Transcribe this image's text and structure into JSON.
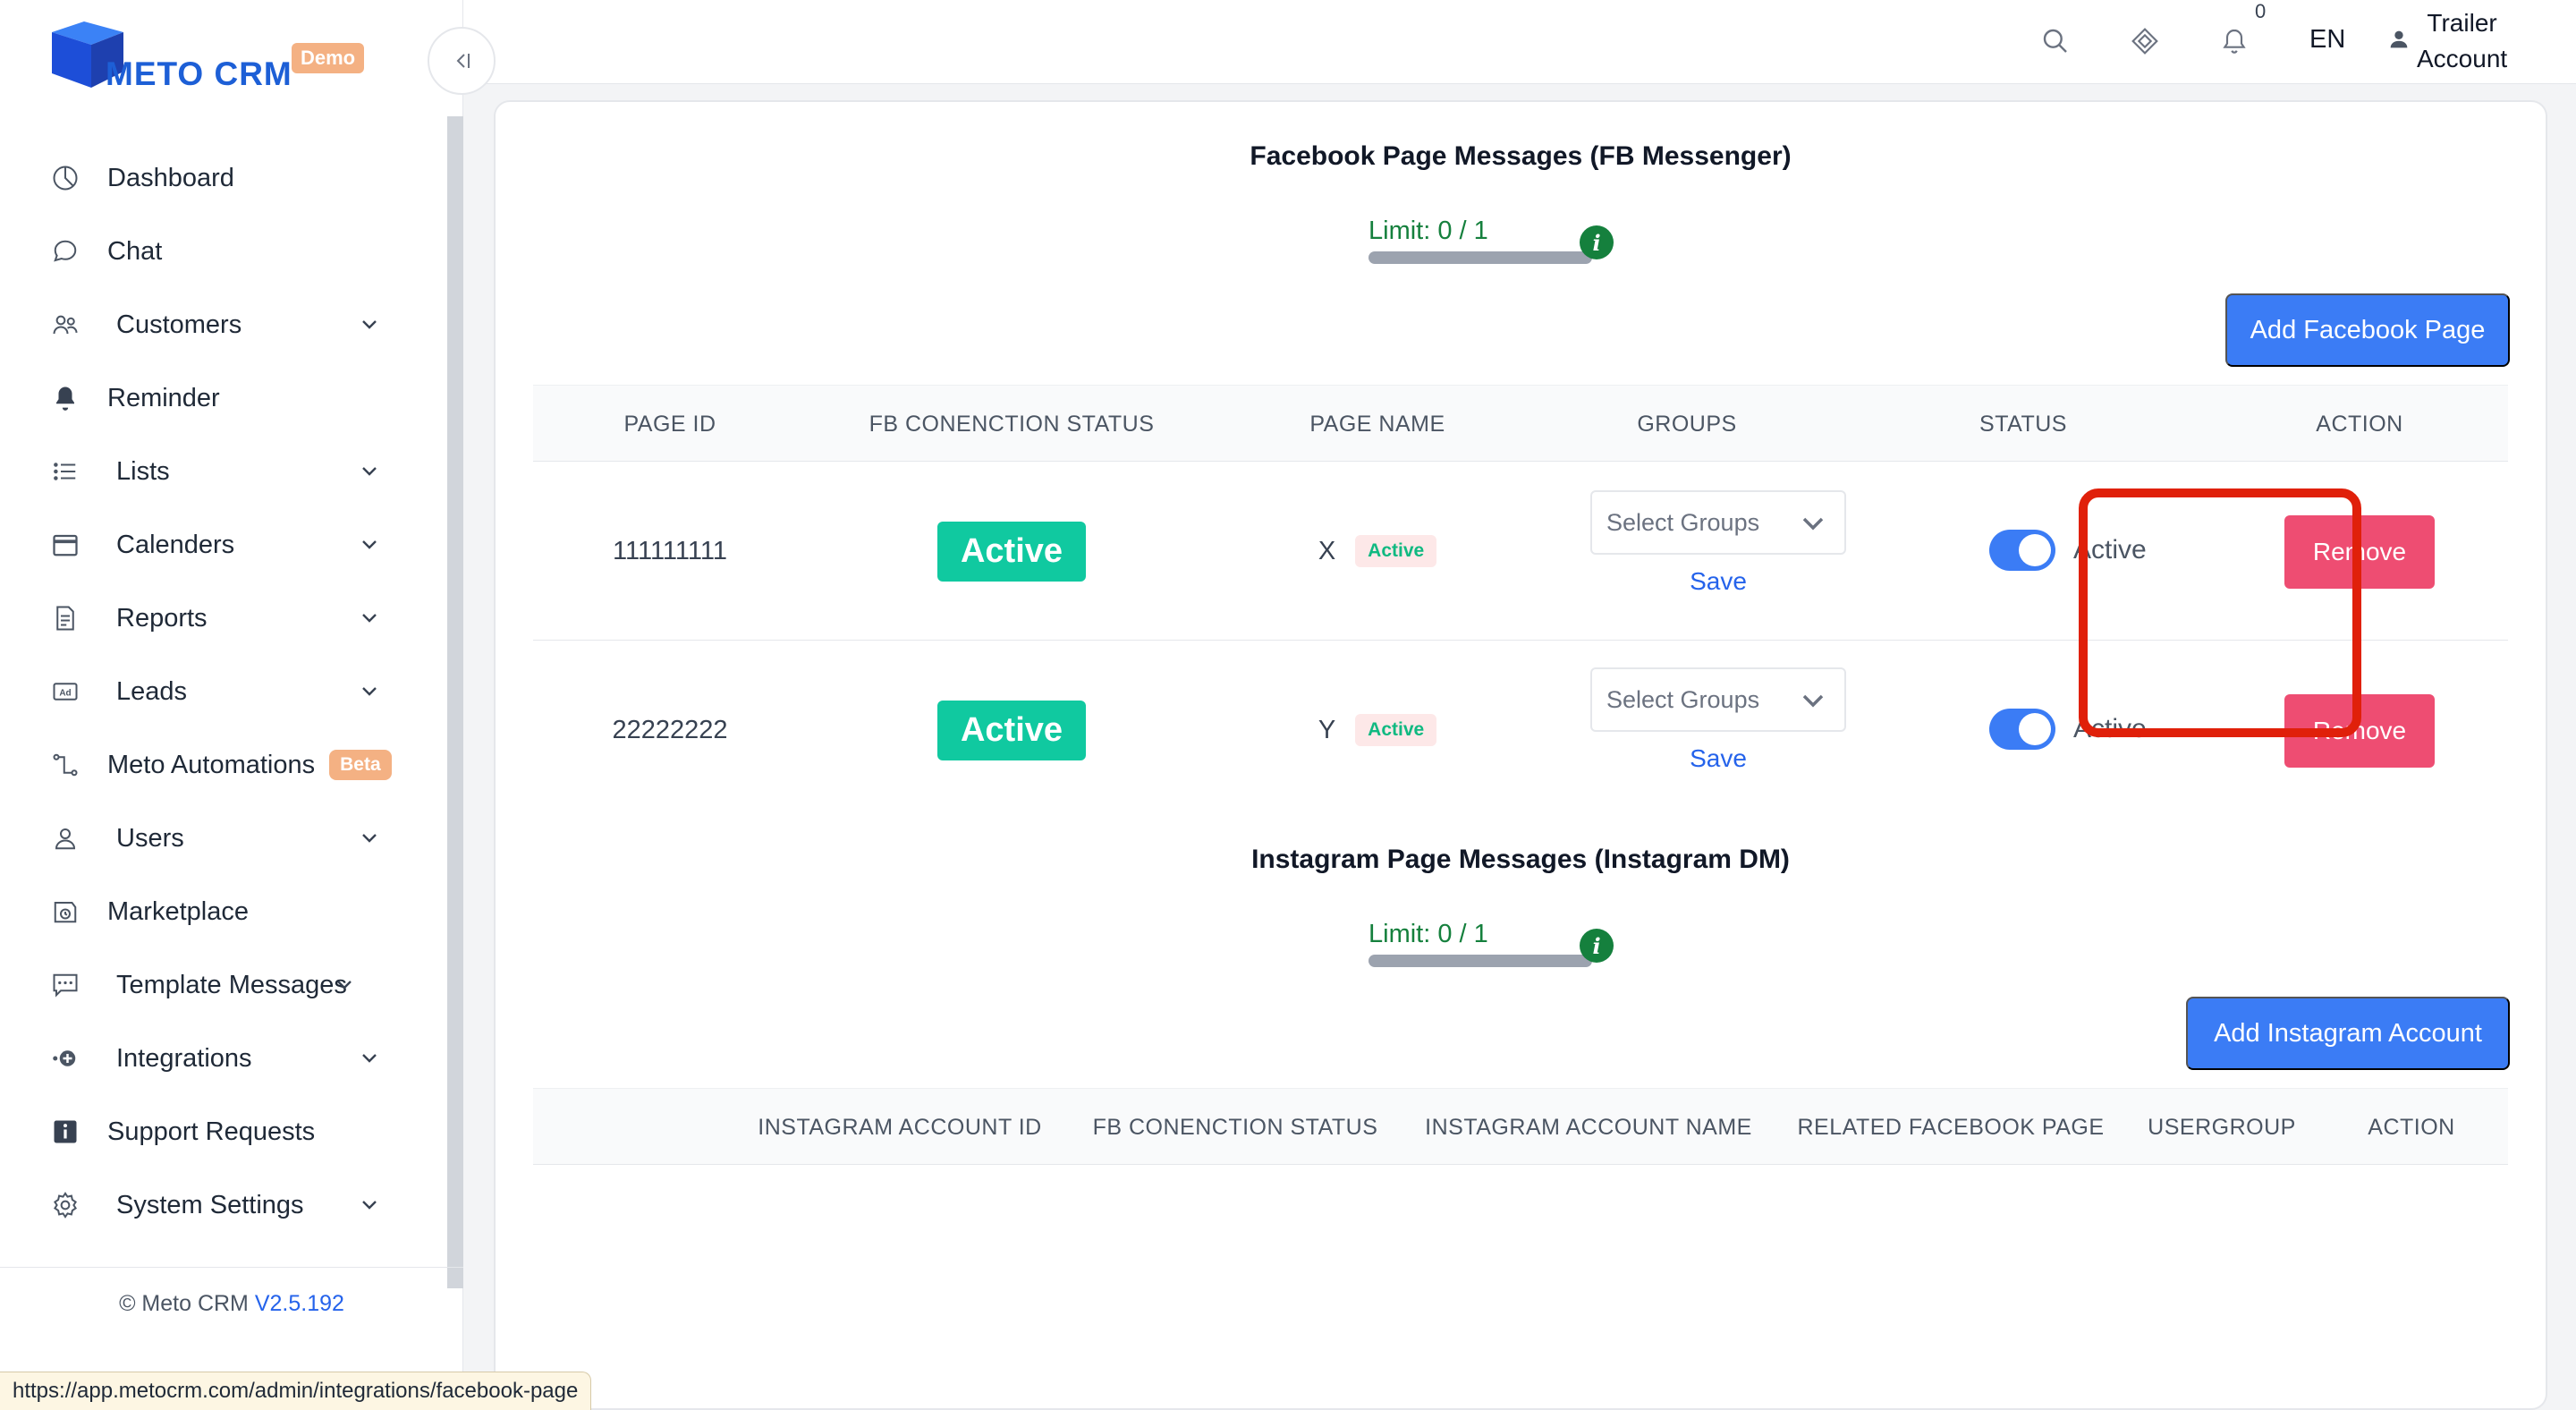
{
  "app": {
    "logo_text": "METO CRM",
    "logo_badge": "Demo",
    "brand_color": "#1d5fd6"
  },
  "sidebar": {
    "items": [
      {
        "label": "Dashboard",
        "icon": "pie-chart-icon",
        "has_submenu": false
      },
      {
        "label": "Chat",
        "icon": "chat-bubble-icon",
        "has_submenu": false
      },
      {
        "label": "Customers",
        "icon": "users-icon",
        "has_submenu": true
      },
      {
        "label": "Reminder",
        "icon": "bell-icon",
        "has_submenu": false
      },
      {
        "label": "Lists",
        "icon": "list-icon",
        "has_submenu": true
      },
      {
        "label": "Calenders",
        "icon": "calendar-icon",
        "has_submenu": true
      },
      {
        "label": "Reports",
        "icon": "document-icon",
        "has_submenu": true
      },
      {
        "label": "Leads",
        "icon": "ad-icon",
        "has_submenu": true
      },
      {
        "label": "Meto Automations",
        "icon": "flow-icon",
        "has_submenu": false,
        "badge": "Beta"
      },
      {
        "label": "Users",
        "icon": "user-icon",
        "has_submenu": true
      },
      {
        "label": "Marketplace",
        "icon": "store-icon",
        "has_submenu": false
      },
      {
        "label": "Template Messages",
        "icon": "message-template-icon",
        "has_submenu": true
      },
      {
        "label": "Integrations",
        "icon": "plug-icon",
        "has_submenu": true
      },
      {
        "label": "Support Requests",
        "icon": "info-square-icon",
        "has_submenu": false
      },
      {
        "label": "System Settings",
        "icon": "gear-icon",
        "has_submenu": true
      }
    ],
    "footer_prefix": "© Meto CRM",
    "footer_version": "V2.5.192"
  },
  "topbar": {
    "notification_count": "0",
    "language": "EN",
    "user_line1": "Trailer",
    "user_line2": "Account"
  },
  "status_bar_url": "https://app.metocrm.com/admin/integrations/facebook-page",
  "facebook": {
    "title": "Facebook Page Messages (FB Messenger)",
    "limit_text": "Limit: 0 / 1",
    "limit_fraction": 0,
    "add_button": "Add Facebook Page",
    "columns": [
      "PAGE ID",
      "FB CONENCTION STATUS",
      "PAGE NAME",
      "GROUPS",
      "STATUS",
      "ACTION"
    ],
    "rows": [
      {
        "page_id": "111111111",
        "connection_status": "Active",
        "page_name": "X",
        "page_badge": "Active",
        "groups_placeholder": "Select Groups",
        "save": "Save",
        "toggle_on": true,
        "status_label": "Active",
        "action": "Remove"
      },
      {
        "page_id": "22222222",
        "connection_status": "Active",
        "page_name": "Y",
        "page_badge": "Active",
        "groups_placeholder": "Select Groups",
        "save": "Save",
        "toggle_on": true,
        "status_label": "Active",
        "action": "Remove"
      }
    ]
  },
  "instagram": {
    "title": "Instagram Page Messages (Instagram DM)",
    "limit_text": "Limit: 0 / 1",
    "limit_fraction": 0,
    "add_button": "Add Instagram Account",
    "columns": [
      "INSTAGRAM ACCOUNT ID",
      "FB CONENCTION STATUS",
      "INSTAGRAM ACCOUNT NAME",
      "RELATED FACEBOOK PAGE",
      "USERGROUP",
      "ACTION"
    ]
  }
}
